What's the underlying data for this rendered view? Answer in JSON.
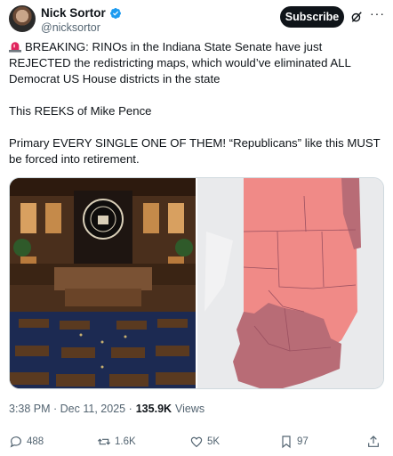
{
  "author": {
    "display_name": "Nick Sortor",
    "handle": "@nicksortor"
  },
  "header": {
    "subscribe_label": "Subscribe"
  },
  "tweet": {
    "line1": "BREAKING: RINOs in the Indiana State Senate have just REJECTED the redistricting maps, which would’ve eliminated ALL Democrat US House districts in the state",
    "line2": "This REEKS of Mike Pence",
    "line3": "Primary EVERY SINGLE ONE OF THEM! “Republicans” like this MUST be forced into retirement."
  },
  "meta": {
    "time": "3:38 PM · Dec 11, 2025 ·",
    "views_count": "135.9K",
    "views_label": "Views"
  },
  "actions": {
    "replies": "488",
    "reposts": "1.6K",
    "likes": "5K",
    "bookmarks": "97"
  },
  "colors": {
    "accent": "#1d9bf0",
    "text": "#0f1419",
    "muted": "#536471",
    "map_light_red": "#f08a87",
    "map_dark_red": "#b86c76"
  },
  "icons": [
    "verified-badge-icon",
    "grok-icon",
    "more-icon",
    "siren-emoji-icon",
    "reply-icon",
    "repost-icon",
    "like-icon",
    "bookmark-icon",
    "share-icon"
  ]
}
